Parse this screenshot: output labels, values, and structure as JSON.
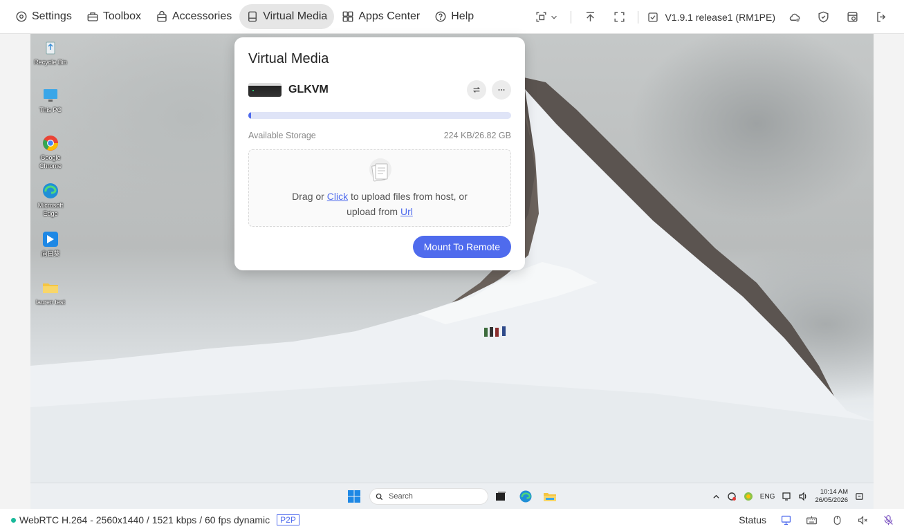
{
  "toolbar": {
    "nav": [
      {
        "label": "Settings",
        "icon": "gear-icon"
      },
      {
        "label": "Toolbox",
        "icon": "toolbox-icon"
      },
      {
        "label": "Accessories",
        "icon": "bag-icon"
      },
      {
        "label": "Virtual Media",
        "icon": "drive-icon"
      },
      {
        "label": "Apps Center",
        "icon": "apps-icon"
      },
      {
        "label": "Help",
        "icon": "help-icon"
      }
    ],
    "active": "Virtual Media",
    "version": "V1.9.1 release1 (RM1PE)"
  },
  "desktop": {
    "icons": [
      {
        "label": "Recycle Bin"
      },
      {
        "label": "This PC"
      },
      {
        "label": "Google Chrome"
      },
      {
        "label": "Microsoft Edge"
      },
      {
        "label": "向日葵"
      },
      {
        "label": "lauren test"
      }
    ]
  },
  "taskbar": {
    "search_placeholder": "Search",
    "lang": "ENG",
    "time": "10:14 AM",
    "date": "26/05/2026"
  },
  "popup": {
    "title": "Virtual Media",
    "device_name": "GLKVM",
    "storage_label": "Available Storage",
    "storage_value": "224 KB/26.82 GB",
    "storage_used_fraction": 0.01,
    "upload_text_1": "Drag or ",
    "click_link": "Click",
    "upload_text_2": " to upload files from host, or",
    "upload_text_3": "upload from ",
    "url_link": "Url",
    "mount_button": "Mount To Remote"
  },
  "statusbar": {
    "stream_info": "WebRTC H.264 - 2560x1440 / 1521 kbps / 60 fps dynamic",
    "badge": "P2P",
    "status_label": "Status"
  },
  "colors": {
    "accent": "#4f6bed",
    "status_ok": "#19b99a"
  }
}
